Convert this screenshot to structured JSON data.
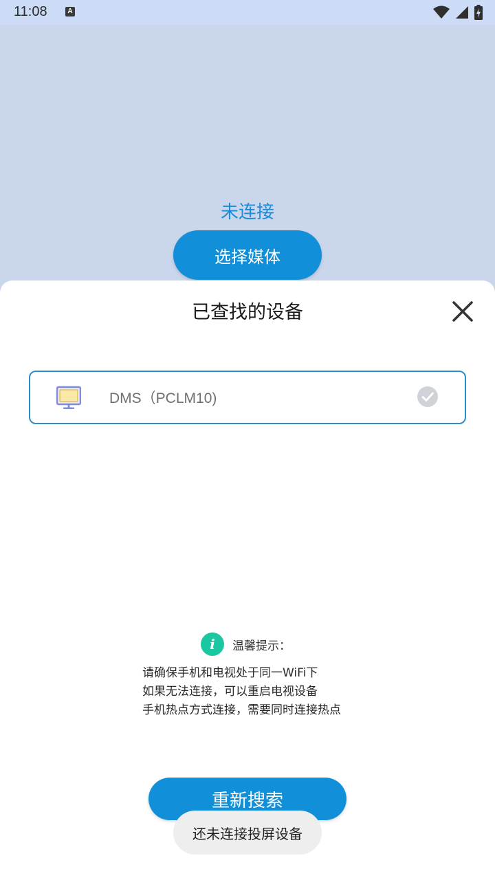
{
  "status_bar": {
    "time": "11:08",
    "notification_icon_letter": "A",
    "icons": [
      "wifi-icon",
      "signal-icon",
      "battery-icon"
    ]
  },
  "background": {
    "status_text": "未连接",
    "choose_media_label": "选择媒体"
  },
  "sheet": {
    "title": "已查找的设备",
    "devices": [
      {
        "name": "DMS（PCLM10)",
        "icon": "monitor-icon",
        "selected_icon": "check-circle-icon"
      }
    ],
    "tip": {
      "title": "温馨提示：",
      "lines": [
        "请确保手机和电视处于同一WiFi下",
        "如果无法连接，可以重启电视设备",
        "手机热点方式连接，需要同时连接热点"
      ]
    },
    "research_label": "重新搜索"
  },
  "toast": {
    "text": "还未连接投屏设备"
  },
  "colors": {
    "accent": "#118fd8",
    "info_green": "#1bc7a0",
    "background": "#c9d6ec"
  }
}
